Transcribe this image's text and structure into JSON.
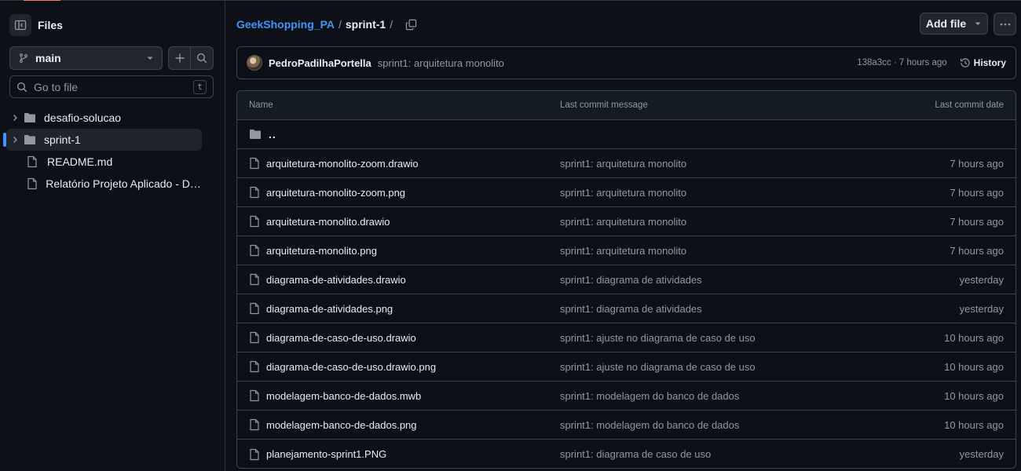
{
  "sidebar": {
    "title": "Files",
    "branch": "main",
    "goto_placeholder": "Go to file",
    "goto_shortcut": "t",
    "tree": [
      {
        "label": "desafio-solucao",
        "type": "folder"
      },
      {
        "label": "sprint-1",
        "type": "folder",
        "active": true
      },
      {
        "label": "README.md",
        "type": "file"
      },
      {
        "label": "Relatório Projeto Aplicado - Desa...",
        "type": "file"
      }
    ]
  },
  "header": {
    "repo": "GeekShopping_PA",
    "sep": "/",
    "current": "sprint-1",
    "add_file": "Add file"
  },
  "commit": {
    "author": "PedroPadilhaPortella",
    "message": "sprint1: arquitetura monolito",
    "meta": "138a3cc · 7 hours ago",
    "history": "History"
  },
  "table": {
    "headers": {
      "name": "Name",
      "message": "Last commit message",
      "date": "Last commit date"
    },
    "parent": "..",
    "rows": [
      {
        "name": "arquitetura-monolito-zoom.drawio",
        "message": "sprint1: arquitetura monolito",
        "date": "7 hours ago"
      },
      {
        "name": "arquitetura-monolito-zoom.png",
        "message": "sprint1: arquitetura monolito",
        "date": "7 hours ago"
      },
      {
        "name": "arquitetura-monolito.drawio",
        "message": "sprint1: arquitetura monolito",
        "date": "7 hours ago"
      },
      {
        "name": "arquitetura-monolito.png",
        "message": "sprint1: arquitetura monolito",
        "date": "7 hours ago"
      },
      {
        "name": "diagrama-de-atividades.drawio",
        "message": "sprint1: diagrama de atividades",
        "date": "yesterday"
      },
      {
        "name": "diagrama-de-atividades.png",
        "message": "sprint1: diagrama de atividades",
        "date": "yesterday"
      },
      {
        "name": "diagrama-de-caso-de-uso.drawio",
        "message": "sprint1: ajuste no diagrama de caso de uso",
        "date": "10 hours ago"
      },
      {
        "name": "diagrama-de-caso-de-uso.drawio.png",
        "message": "sprint1: ajuste no diagrama de caso de uso",
        "date": "10 hours ago"
      },
      {
        "name": "modelagem-banco-de-dados.mwb",
        "message": "sprint1: modelagem do banco de dados",
        "date": "10 hours ago"
      },
      {
        "name": "modelagem-banco-de-dados.png",
        "message": "sprint1: modelagem do banco de dados",
        "date": "10 hours ago"
      },
      {
        "name": "planejamento-sprint1.PNG",
        "message": "sprint1: diagrama de caso de uso",
        "date": "yesterday"
      }
    ]
  },
  "colors": {
    "accent": "#4493f8",
    "bg": "#0d1117",
    "border": "#3d444d",
    "muted": "#9198a1"
  }
}
